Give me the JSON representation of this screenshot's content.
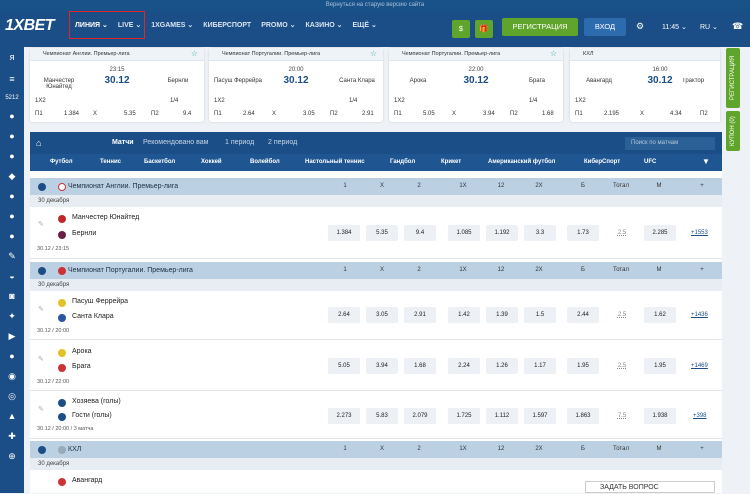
{
  "notice": "Вернуться на старую версию сайта",
  "brand": "1XBET",
  "topnav": [
    "ЛИНИЯ ⌄",
    "LIVE ⌄",
    "1XGAMES ⌄",
    "КИБЕРСПОРТ",
    "PROMO ⌄",
    "КАЗИНО ⌄",
    "ЕЩЁ ⌄"
  ],
  "header": {
    "register": "РЕГИСТРАЦИЯ",
    "login": "ВХОД",
    "time": "11:45 ⌄",
    "lang": "RU ⌄",
    "balance_icon": "$"
  },
  "left_badge": "5212",
  "cards": [
    {
      "league": "Чемпионат Англии. Премьер-лига",
      "t1": "Манчестер Юнайтед",
      "t2": "Бернли",
      "time": "23:15",
      "date": "30.12",
      "label": "1X2",
      "page": "1/4",
      "odds": [
        [
          "П1",
          "1.384"
        ],
        [
          "X",
          "5.35"
        ],
        [
          "П2",
          "9.4"
        ]
      ]
    },
    {
      "league": "Чемпионат Португалии. Премьер-лига",
      "t1": "Пасуш Феррейра",
      "t2": "Санта Клара",
      "time": "20:00",
      "date": "30.12",
      "label": "1X2",
      "page": "1/4",
      "odds": [
        [
          "П1",
          "2.64"
        ],
        [
          "X",
          "3.05"
        ],
        [
          "П2",
          "2.91"
        ]
      ]
    },
    {
      "league": "Чемпионат Португалии. Премьер-лига",
      "t1": "Арока",
      "t2": "Брага",
      "time": "22:00",
      "date": "30.12",
      "label": "1X2",
      "page": "1/4",
      "odds": [
        [
          "П1",
          "5.05"
        ],
        [
          "X",
          "3.94"
        ],
        [
          "П2",
          "1.68"
        ]
      ]
    },
    {
      "league": "КХЛ",
      "t1": "Авангард",
      "t2": "Трактор",
      "time": "16:00",
      "date": "30.12",
      "label": "1X2",
      "page": "",
      "odds": [
        [
          "П1",
          "2.195"
        ],
        [
          "X",
          "4.34"
        ],
        [
          "П2",
          "2.84"
        ]
      ]
    }
  ],
  "subtabs": [
    "Матчи",
    "Рекомендовано вам",
    "1 период",
    "2 период"
  ],
  "search_placeholder": "Поиск по матчам",
  "sports": [
    "Футбол",
    "Теннис",
    "Баскетбол",
    "Хоккей",
    "Волейбол",
    "Настольный теннис",
    "Гандбол",
    "Крикет",
    "Американский футбол",
    "КиберСпорт",
    "UFC"
  ],
  "columns": [
    "1",
    "X",
    "2",
    "1X",
    "12",
    "2X",
    "Б",
    "Тотал",
    "М",
    "+"
  ],
  "leagues": [
    {
      "name": "Чемпионат Англии. Премьер-лига",
      "date": "30 декабря",
      "matches": [
        {
          "t1": "Манчестер Юнайтед",
          "t2": "Бернли",
          "meta": "30.12 / 23:15",
          "odds": [
            "1.384",
            "5.35",
            "9.4",
            "1.085",
            "1.192",
            "3.3",
            "1.73",
            "2.5",
            "2.285"
          ],
          "plus": "+1553"
        }
      ]
    },
    {
      "name": "Чемпионат Португалии. Премьер-лига",
      "date": "30 декабря",
      "matches": [
        {
          "t1": "Пасуш Феррейра",
          "t2": "Санта Клара",
          "meta": "30.12 / 20:00",
          "odds": [
            "2.64",
            "3.05",
            "2.91",
            "1.42",
            "1.39",
            "1.5",
            "2.44",
            "2.5",
            "1.62"
          ],
          "plus": "+1436"
        },
        {
          "t1": "Арока",
          "t2": "Брага",
          "meta": "30.12 / 22:00",
          "odds": [
            "5.05",
            "3.94",
            "1.68",
            "2.24",
            "1.26",
            "1.17",
            "1.95",
            "2.5",
            "1.95"
          ],
          "plus": "+1469"
        },
        {
          "t1": "Хозяева (голы)",
          "t2": "Гости (голы)",
          "meta": "30.12 / 20:00 / 3 матча",
          "odds": [
            "2.273",
            "5.83",
            "2.079",
            "1.725",
            "1.112",
            "1.597",
            "1.863",
            "7.5",
            "1.938"
          ],
          "plus": "+398"
        }
      ]
    },
    {
      "name": "КХЛ",
      "date": "30 декабря",
      "matches": [
        {
          "t1": "Авангард",
          "t2": "",
          "meta": "",
          "odds": [],
          "plus": ""
        }
      ]
    }
  ],
  "right_tabs": [
    "РЕГИСТРАЦИЯ",
    "КУПОН (0)"
  ],
  "ask": "ЗАДАТЬ ВОПРОС"
}
